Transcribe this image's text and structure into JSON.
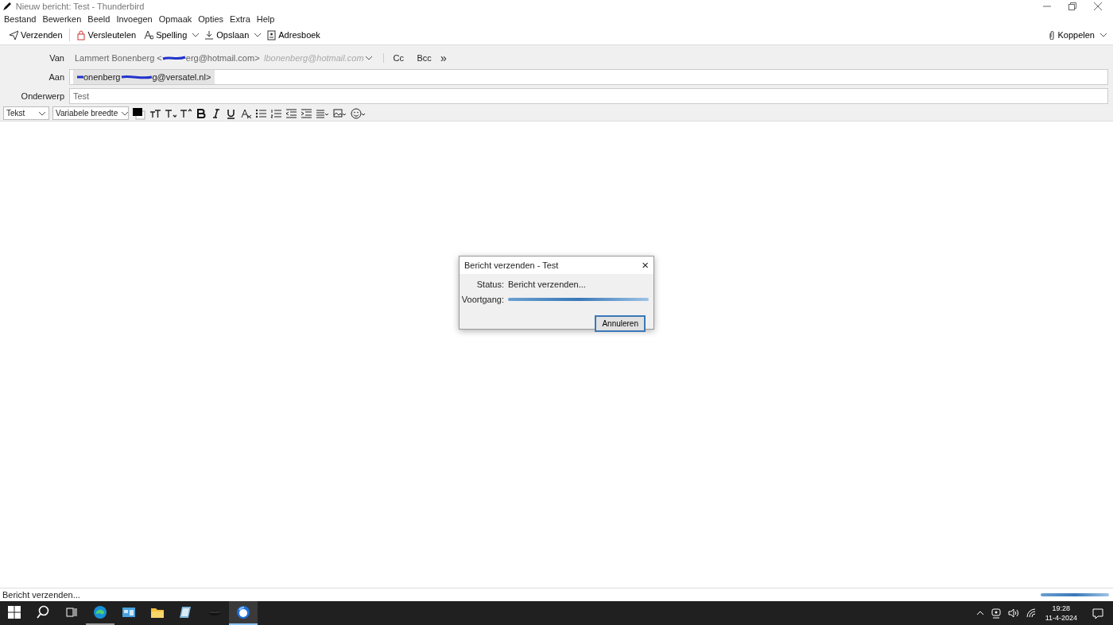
{
  "window": {
    "title": "Nieuw bericht: Test - Thunderbird"
  },
  "menu": [
    "Bestand",
    "Bewerken",
    "Beeld",
    "Invoegen",
    "Opmaak",
    "Opties",
    "Extra",
    "Help"
  ],
  "toolbar": [
    {
      "kind": "send",
      "label": "Verzenden"
    },
    {
      "kind": "encrypt",
      "label": "Versleutelen"
    },
    {
      "kind": "spell",
      "label": "Spelling",
      "dropdown": true
    },
    {
      "kind": "save",
      "label": "Opslaan",
      "dropdown": true
    },
    {
      "kind": "book",
      "label": "Adresboek"
    }
  ],
  "attach": {
    "label": "Koppelen"
  },
  "header": {
    "from_label": "Van",
    "from_name": "Lammert Bonenberg <",
    "from_rest": "erg@hotmail.com>",
    "identity": "lbonenberg@hotmail.com",
    "cc": "Cc",
    "bcc": "Bcc",
    "more": "»",
    "to_label": "Aan",
    "to_parts": [
      "onenberg",
      "g@versatel.nl>"
    ],
    "subject_label": "Onderwerp",
    "subject": "Test"
  },
  "format": {
    "paragraph": "Tekst",
    "font": "Variabele breedte",
    "buttons": [
      {
        "kind": "smaller"
      },
      {
        "kind": "smaller-sub"
      },
      {
        "kind": "larger-sup"
      },
      {
        "kind": "bold"
      },
      {
        "kind": "italic"
      },
      {
        "kind": "underline"
      },
      {
        "kind": "clear"
      },
      {
        "kind": "bullets"
      },
      {
        "kind": "numbers"
      },
      {
        "kind": "outdent"
      },
      {
        "kind": "indent"
      },
      {
        "kind": "align"
      },
      {
        "kind": "image"
      },
      {
        "kind": "emoji"
      }
    ]
  },
  "dialog": {
    "title": "Bericht verzenden - Test",
    "close": "×",
    "status_label": "Status:",
    "status": "Bericht verzenden...",
    "progress_label": "Voortgang:",
    "level": 1,
    "cancel": "Annuleren"
  },
  "status_bar": {
    "text": "Bericht verzenden...",
    "level": 1
  },
  "taskbar": {
    "apps": [
      {
        "kind": "edge",
        "running": true,
        "selected": false
      },
      {
        "kind": "panel",
        "running": false,
        "selected": false
      },
      {
        "kind": "folder",
        "running": false,
        "selected": false
      },
      {
        "kind": "notepad",
        "running": false,
        "selected": false
      },
      {
        "kind": "dark",
        "running": false,
        "selected": false
      },
      {
        "kind": "thunderbird",
        "running": true,
        "selected": true
      }
    ],
    "time": "19:28",
    "date": "11-4-2024"
  }
}
